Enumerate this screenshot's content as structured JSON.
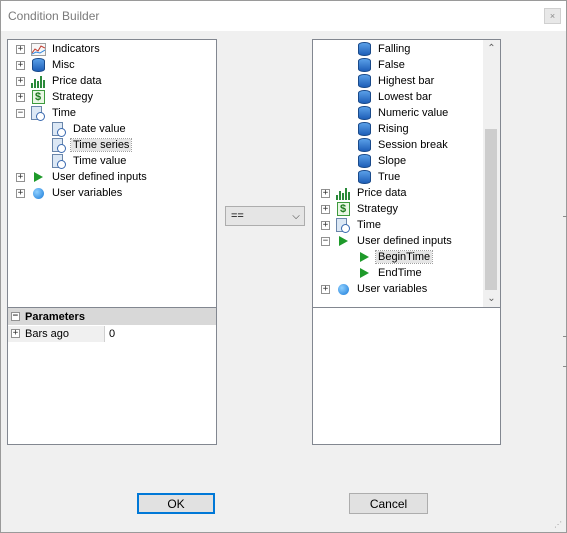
{
  "window": {
    "title": "Condition Builder",
    "close_label": "×"
  },
  "left_tree": [
    {
      "label": "Indicators",
      "expander": "+",
      "icon": "chart-lines-icon"
    },
    {
      "label": "Misc",
      "expander": "+",
      "icon": "database-icon"
    },
    {
      "label": "Price data",
      "expander": "+",
      "icon": "bar-chart-icon"
    },
    {
      "label": "Strategy",
      "expander": "+",
      "icon": "dollar-icon"
    },
    {
      "label": "Time",
      "expander": "−",
      "icon": "clock-doc-icon"
    },
    {
      "label": "Date value",
      "expander": "",
      "icon": "clock-doc-icon"
    },
    {
      "label": "Time series",
      "expander": "",
      "icon": "clock-doc-icon",
      "selected": true
    },
    {
      "label": "Time value",
      "expander": "",
      "icon": "clock-doc-icon"
    },
    {
      "label": "User defined inputs",
      "expander": "+",
      "icon": "play-icon"
    },
    {
      "label": "User variables",
      "expander": "+",
      "icon": "globe-icon"
    }
  ],
  "parameters": {
    "header": "Parameters",
    "header_expander": "−",
    "rows": [
      {
        "expander": "+",
        "name": "Bars ago",
        "value": "0"
      }
    ]
  },
  "operator": {
    "value": "==",
    "arrow": "⌵"
  },
  "right_tree": [
    {
      "label": "Falling",
      "expander": "",
      "icon": "database-icon"
    },
    {
      "label": "False",
      "expander": "",
      "icon": "database-icon"
    },
    {
      "label": "Highest bar",
      "expander": "",
      "icon": "database-icon"
    },
    {
      "label": "Lowest bar",
      "expander": "",
      "icon": "database-icon"
    },
    {
      "label": "Numeric value",
      "expander": "",
      "icon": "database-icon"
    },
    {
      "label": "Rising",
      "expander": "",
      "icon": "database-icon"
    },
    {
      "label": "Session break",
      "expander": "",
      "icon": "database-icon"
    },
    {
      "label": "Slope",
      "expander": "",
      "icon": "database-icon"
    },
    {
      "label": "True",
      "expander": "",
      "icon": "database-icon"
    },
    {
      "label": "Price data",
      "expander": "+",
      "icon": "bar-chart-icon"
    },
    {
      "label": "Strategy",
      "expander": "+",
      "icon": "dollar-icon"
    },
    {
      "label": "Time",
      "expander": "+",
      "icon": "clock-doc-icon"
    },
    {
      "label": "User defined inputs",
      "expander": "−",
      "icon": "play-icon"
    },
    {
      "label": "BeginTime",
      "expander": "",
      "icon": "play-outline-icon",
      "selected": true
    },
    {
      "label": "EndTime",
      "expander": "",
      "icon": "play-icon"
    },
    {
      "label": "User variables",
      "expander": "+",
      "icon": "globe-icon"
    }
  ],
  "scrollbar": {
    "up_arrow": "⌃",
    "down_arrow": "⌄"
  },
  "buttons": {
    "ok": "OK",
    "cancel": "Cancel"
  },
  "colors": {
    "accent": "#0078d7",
    "window_bg": "#f0f0f0",
    "panel_border": "#828790",
    "selection": "#e5e5e5"
  }
}
